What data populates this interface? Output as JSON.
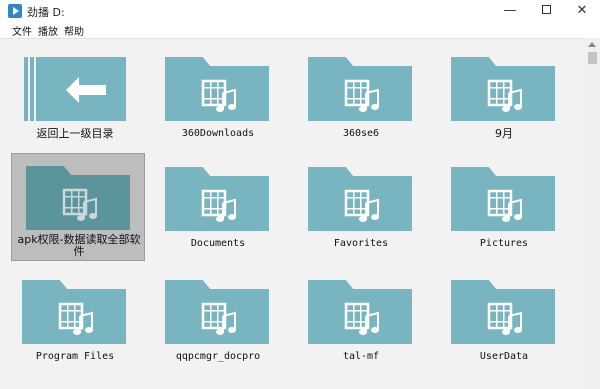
{
  "window": {
    "title": "劲播  D:",
    "minimize_glyph": "—",
    "close_glyph": "✕"
  },
  "menu": {
    "items": [
      "文件",
      "播放",
      "帮助"
    ]
  },
  "icons": {
    "app": "play-app-icon",
    "folder": "video-folder-icon",
    "back": "back-arrow-icon"
  },
  "colors": {
    "folder": "#79b5c0",
    "folder_selected": "#5c949b",
    "selected_bg": "#bdbdbd"
  },
  "folders": [
    "返回上一级目录",
    "360Downloads",
    "360se6",
    "9月",
    "apk权限-数据读取全部软件",
    "Documents",
    "Favorites",
    "Pictures",
    "Program Files",
    "qqpcmgr_docpro",
    "tal-mf",
    "UserData"
  ],
  "selected_index": 4
}
